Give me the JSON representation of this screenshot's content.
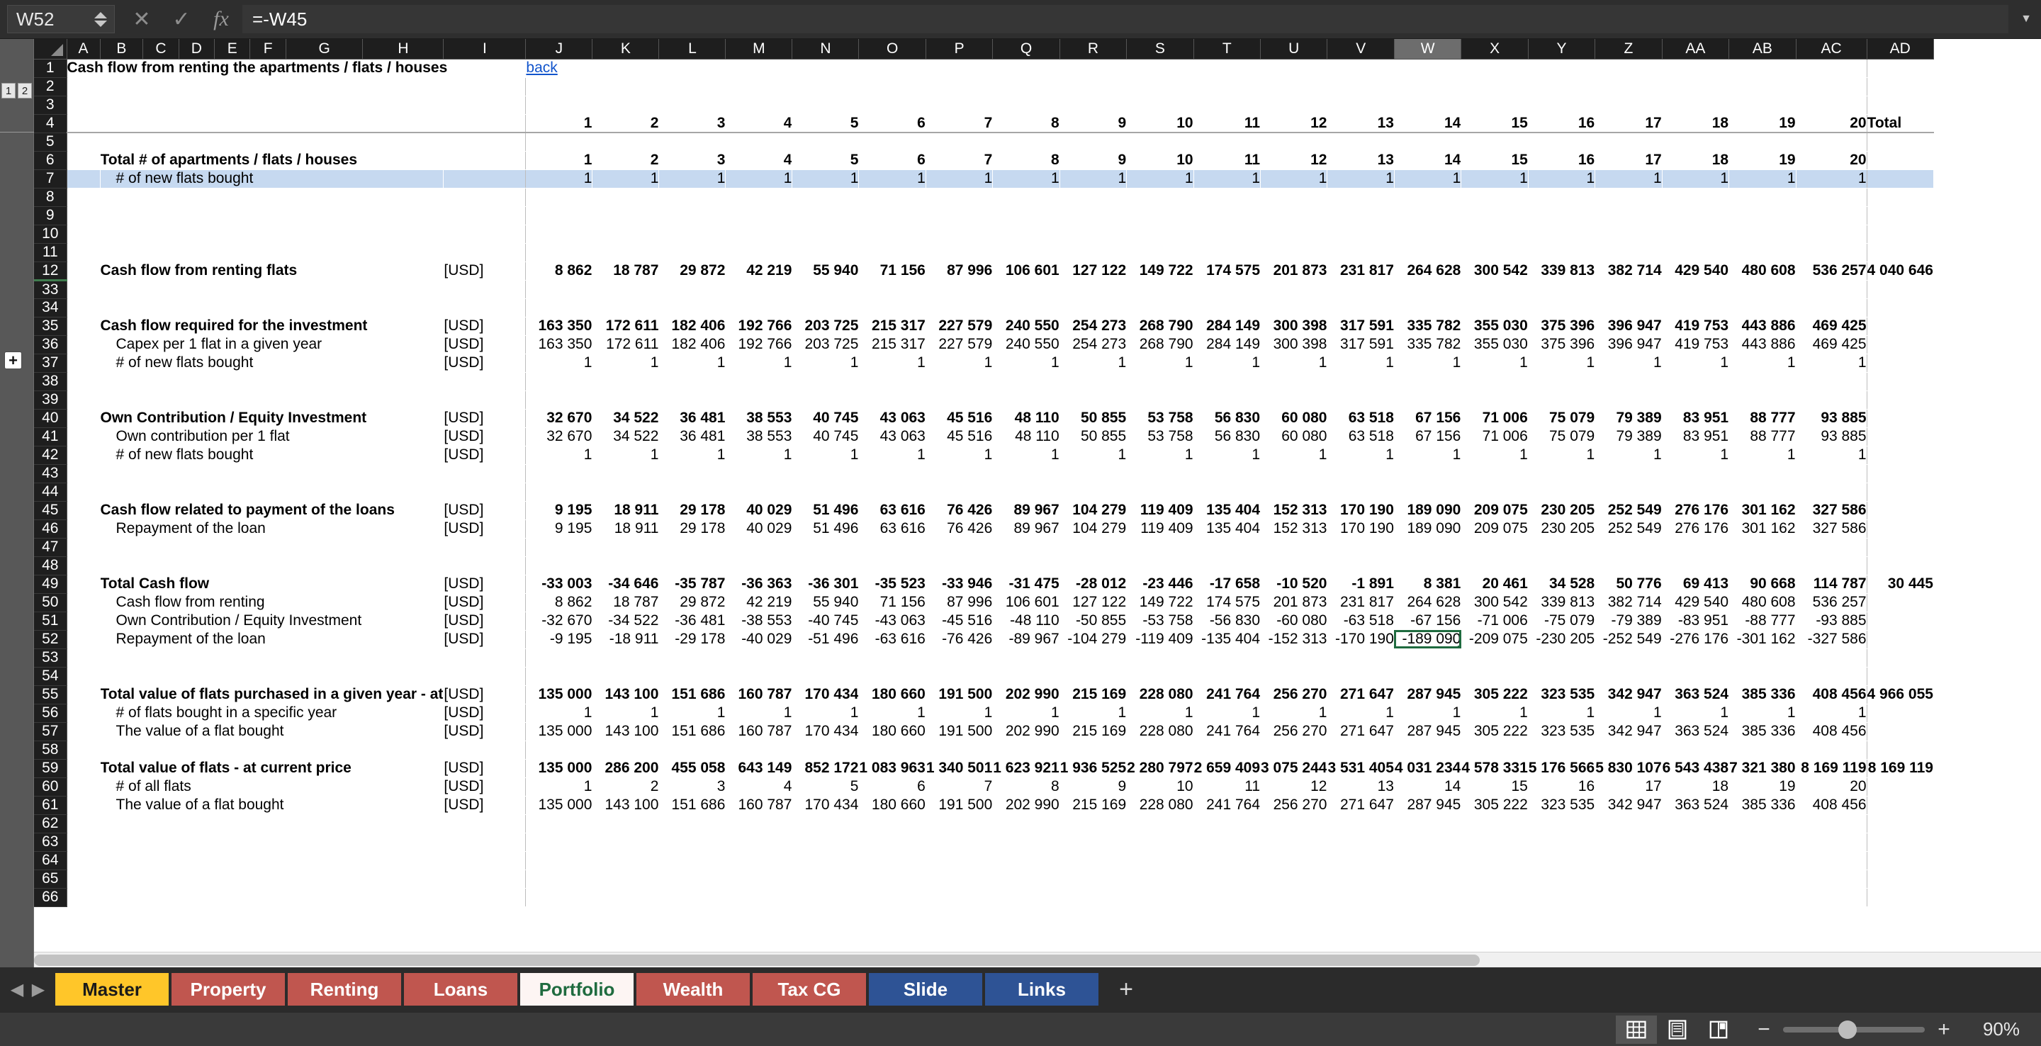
{
  "formula_bar": {
    "name_box": "W52",
    "cancel_icon": "close-icon",
    "accept_icon": "check-icon",
    "function_icon": "fx-icon",
    "formula": "=-W45",
    "expand_icon": "chevron-down-icon"
  },
  "outline": {
    "level_1": "1",
    "level_2": "2",
    "expand": "+"
  },
  "columns": [
    "A",
    "B",
    "C",
    "D",
    "E",
    "F",
    "G",
    "H",
    "I",
    "J",
    "K",
    "L",
    "M",
    "N",
    "O",
    "P",
    "Q",
    "R",
    "S",
    "T",
    "U",
    "V",
    "W",
    "X",
    "Y",
    "Z",
    "AA",
    "AB",
    "AC",
    "AD"
  ],
  "selected_column": "W",
  "rows": [
    "1",
    "2",
    "3",
    "4",
    "5",
    "6",
    "7",
    "8",
    "9",
    "10",
    "11",
    "12",
    "33",
    "34",
    "35",
    "36",
    "37",
    "38",
    "39",
    "40",
    "41",
    "42",
    "43",
    "44",
    "45",
    "46",
    "47",
    "48",
    "49",
    "50",
    "51",
    "52",
    "53",
    "54",
    "55",
    "56",
    "57",
    "58",
    "59",
    "60",
    "61",
    "62",
    "63",
    "64",
    "65",
    "66"
  ],
  "title": "Cash flow from renting the apartments / flats / houses",
  "back_link": "back",
  "year_headers": [
    "1",
    "2",
    "3",
    "4",
    "5",
    "6",
    "7",
    "8",
    "9",
    "10",
    "11",
    "12",
    "13",
    "14",
    "15",
    "16",
    "17",
    "18",
    "19",
    "20"
  ],
  "total_header": "Total",
  "unit": "[USD]",
  "sheet_rows": [
    {
      "row": "6",
      "label": "Total # of apartments / flats / houses",
      "bold": true,
      "indent": 0,
      "unit": "",
      "values": [
        "1",
        "2",
        "3",
        "4",
        "5",
        "6",
        "7",
        "8",
        "9",
        "10",
        "11",
        "12",
        "13",
        "14",
        "15",
        "16",
        "17",
        "18",
        "19",
        "20"
      ],
      "total": ""
    },
    {
      "row": "7",
      "label": "# of new flats bought",
      "bold": false,
      "indent": 1,
      "unit": "",
      "highlight": true,
      "values": [
        "1",
        "1",
        "1",
        "1",
        "1",
        "1",
        "1",
        "1",
        "1",
        "1",
        "1",
        "1",
        "1",
        "1",
        "1",
        "1",
        "1",
        "1",
        "1",
        "1"
      ],
      "total": ""
    },
    {
      "row": "12",
      "label": "Cash flow from renting flats",
      "bold": true,
      "indent": 0,
      "unit": "[USD]",
      "values": [
        "8 862",
        "18 787",
        "29 872",
        "42 219",
        "55 940",
        "71 156",
        "87 996",
        "106 601",
        "127 122",
        "149 722",
        "174 575",
        "201 873",
        "231 817",
        "264 628",
        "300 542",
        "339 813",
        "382 714",
        "429 540",
        "480 608",
        "536 257"
      ],
      "total": "4 040 646"
    },
    {
      "row": "35",
      "label": "Cash flow required for the investment",
      "bold": true,
      "indent": 0,
      "unit": "[USD]",
      "values": [
        "163 350",
        "172 611",
        "182 406",
        "192 766",
        "203 725",
        "215 317",
        "227 579",
        "240 550",
        "254 273",
        "268 790",
        "284 149",
        "300 398",
        "317 591",
        "335 782",
        "355 030",
        "375 396",
        "396 947",
        "419 753",
        "443 886",
        "469 425"
      ],
      "total": ""
    },
    {
      "row": "36",
      "label": "Capex per 1 flat in a given year",
      "bold": false,
      "indent": 1,
      "unit": "[USD]",
      "values": [
        "163 350",
        "172 611",
        "182 406",
        "192 766",
        "203 725",
        "215 317",
        "227 579",
        "240 550",
        "254 273",
        "268 790",
        "284 149",
        "300 398",
        "317 591",
        "335 782",
        "355 030",
        "375 396",
        "396 947",
        "419 753",
        "443 886",
        "469 425"
      ],
      "total": ""
    },
    {
      "row": "37",
      "label": "# of new flats bought",
      "bold": false,
      "indent": 1,
      "unit": "[USD]",
      "values": [
        "1",
        "1",
        "1",
        "1",
        "1",
        "1",
        "1",
        "1",
        "1",
        "1",
        "1",
        "1",
        "1",
        "1",
        "1",
        "1",
        "1",
        "1",
        "1",
        "1"
      ],
      "total": ""
    },
    {
      "row": "40",
      "label": "Own Contribution / Equity Investment",
      "bold": true,
      "indent": 0,
      "unit": "[USD]",
      "values": [
        "32 670",
        "34 522",
        "36 481",
        "38 553",
        "40 745",
        "43 063",
        "45 516",
        "48 110",
        "50 855",
        "53 758",
        "56 830",
        "60 080",
        "63 518",
        "67 156",
        "71 006",
        "75 079",
        "79 389",
        "83 951",
        "88 777",
        "93 885"
      ],
      "total": ""
    },
    {
      "row": "41",
      "label": "Own contribution per 1 flat",
      "bold": false,
      "indent": 1,
      "unit": "[USD]",
      "values": [
        "32 670",
        "34 522",
        "36 481",
        "38 553",
        "40 745",
        "43 063",
        "45 516",
        "48 110",
        "50 855",
        "53 758",
        "56 830",
        "60 080",
        "63 518",
        "67 156",
        "71 006",
        "75 079",
        "79 389",
        "83 951",
        "88 777",
        "93 885"
      ],
      "total": ""
    },
    {
      "row": "42",
      "label": "# of new flats bought",
      "bold": false,
      "indent": 1,
      "unit": "[USD]",
      "values": [
        "1",
        "1",
        "1",
        "1",
        "1",
        "1",
        "1",
        "1",
        "1",
        "1",
        "1",
        "1",
        "1",
        "1",
        "1",
        "1",
        "1",
        "1",
        "1",
        "1"
      ],
      "total": ""
    },
    {
      "row": "45",
      "label": "Cash flow related to payment of the loans",
      "bold": true,
      "indent": 0,
      "unit": "[USD]",
      "values": [
        "9 195",
        "18 911",
        "29 178",
        "40 029",
        "51 496",
        "63 616",
        "76 426",
        "89 967",
        "104 279",
        "119 409",
        "135 404",
        "152 313",
        "170 190",
        "189 090",
        "209 075",
        "230 205",
        "252 549",
        "276 176",
        "301 162",
        "327 586"
      ],
      "total": ""
    },
    {
      "row": "46",
      "label": "Repayment of the loan",
      "bold": false,
      "indent": 1,
      "unit": "[USD]",
      "values": [
        "9 195",
        "18 911",
        "29 178",
        "40 029",
        "51 496",
        "63 616",
        "76 426",
        "89 967",
        "104 279",
        "119 409",
        "135 404",
        "152 313",
        "170 190",
        "189 090",
        "209 075",
        "230 205",
        "252 549",
        "276 176",
        "301 162",
        "327 586"
      ],
      "total": ""
    },
    {
      "row": "49",
      "label": "Total Cash flow",
      "bold": true,
      "indent": 0,
      "unit": "[USD]",
      "values": [
        "-33 003",
        "-34 646",
        "-35 787",
        "-36 363",
        "-36 301",
        "-35 523",
        "-33 946",
        "-31 475",
        "-28 012",
        "-23 446",
        "-17 658",
        "-10 520",
        "-1 891",
        "8 381",
        "20 461",
        "34 528",
        "50 776",
        "69 413",
        "90 668",
        "114 787"
      ],
      "total": "30 445"
    },
    {
      "row": "50",
      "label": "Cash flow from renting",
      "bold": false,
      "indent": 1,
      "unit": "[USD]",
      "values": [
        "8 862",
        "18 787",
        "29 872",
        "42 219",
        "55 940",
        "71 156",
        "87 996",
        "106 601",
        "127 122",
        "149 722",
        "174 575",
        "201 873",
        "231 817",
        "264 628",
        "300 542",
        "339 813",
        "382 714",
        "429 540",
        "480 608",
        "536 257"
      ],
      "total": ""
    },
    {
      "row": "51",
      "label": "Own Contribution / Equity Investment",
      "bold": false,
      "indent": 1,
      "unit": "[USD]",
      "values": [
        "-32 670",
        "-34 522",
        "-36 481",
        "-38 553",
        "-40 745",
        "-43 063",
        "-45 516",
        "-48 110",
        "-50 855",
        "-53 758",
        "-56 830",
        "-60 080",
        "-63 518",
        "-67 156",
        "-71 006",
        "-75 079",
        "-79 389",
        "-83 951",
        "-88 777",
        "-93 885"
      ],
      "total": ""
    },
    {
      "row": "52",
      "label": "Repayment of the loan",
      "bold": false,
      "indent": 1,
      "unit": "[USD]",
      "selected_index": 13,
      "values": [
        "-9 195",
        "-18 911",
        "-29 178",
        "-40 029",
        "-51 496",
        "-63 616",
        "-76 426",
        "-89 967",
        "-104 279",
        "-119 409",
        "-135 404",
        "-152 313",
        "-170 190",
        "-189 090",
        "-209 075",
        "-230 205",
        "-252 549",
        "-276 176",
        "-301 162",
        "-327 586"
      ],
      "total": ""
    },
    {
      "row": "55",
      "label": "Total value of flats purchased in a given year - at ",
      "bold": true,
      "indent": 0,
      "unit": "[USD]",
      "clipped": true,
      "values": [
        "135 000",
        "143 100",
        "151 686",
        "160 787",
        "170 434",
        "180 660",
        "191 500",
        "202 990",
        "215 169",
        "228 080",
        "241 764",
        "256 270",
        "271 647",
        "287 945",
        "305 222",
        "323 535",
        "342 947",
        "363 524",
        "385 336",
        "408 456"
      ],
      "total": "4 966 055"
    },
    {
      "row": "56",
      "label": "# of flats bought in a specific year",
      "bold": false,
      "indent": 1,
      "unit": "[USD]",
      "values": [
        "1",
        "1",
        "1",
        "1",
        "1",
        "1",
        "1",
        "1",
        "1",
        "1",
        "1",
        "1",
        "1",
        "1",
        "1",
        "1",
        "1",
        "1",
        "1",
        "1"
      ],
      "total": ""
    },
    {
      "row": "57",
      "label": "The value of a flat bought",
      "bold": false,
      "indent": 1,
      "unit": "[USD]",
      "values": [
        "135 000",
        "143 100",
        "151 686",
        "160 787",
        "170 434",
        "180 660",
        "191 500",
        "202 990",
        "215 169",
        "228 080",
        "241 764",
        "256 270",
        "271 647",
        "287 945",
        "305 222",
        "323 535",
        "342 947",
        "363 524",
        "385 336",
        "408 456"
      ],
      "total": ""
    },
    {
      "row": "59",
      "label": "Total value of flats - at current price",
      "bold": true,
      "indent": 0,
      "unit": "[USD]",
      "values": [
        "135 000",
        "286 200",
        "455 058",
        "643 149",
        "852 172",
        "1 083 963",
        "1 340 501",
        "1 623 921",
        "1 936 525",
        "2 280 797",
        "2 659 409",
        "3 075 244",
        "3 531 405",
        "4 031 234",
        "4 578 331",
        "5 176 566",
        "5 830 107",
        "6 543 438",
        "7 321 380",
        "8 169 119"
      ],
      "total": "8 169 119"
    },
    {
      "row": "60",
      "label": "# of all flats",
      "bold": false,
      "indent": 1,
      "unit": "[USD]",
      "values": [
        "1",
        "2",
        "3",
        "4",
        "5",
        "6",
        "7",
        "8",
        "9",
        "10",
        "11",
        "12",
        "13",
        "14",
        "15",
        "16",
        "17",
        "18",
        "19",
        "20"
      ],
      "total": ""
    },
    {
      "row": "61",
      "label": "The value of a flat bought",
      "bold": false,
      "indent": 1,
      "unit": "[USD]",
      "values": [
        "135 000",
        "143 100",
        "151 686",
        "160 787",
        "170 434",
        "180 660",
        "191 500",
        "202 990",
        "215 169",
        "228 080",
        "241 764",
        "256 270",
        "271 647",
        "287 945",
        "305 222",
        "323 535",
        "342 947",
        "363 524",
        "385 336",
        "408 456"
      ],
      "total": ""
    }
  ],
  "tabs": [
    {
      "label": "Master",
      "style": "master",
      "active": false
    },
    {
      "label": "Property",
      "style": "red",
      "active": false
    },
    {
      "label": "Renting",
      "style": "red",
      "active": false
    },
    {
      "label": "Loans",
      "style": "red",
      "active": false
    },
    {
      "label": "Portfolio",
      "style": "active",
      "active": true
    },
    {
      "label": "Wealth",
      "style": "red",
      "active": false
    },
    {
      "label": "Tax CG",
      "style": "red",
      "active": false
    },
    {
      "label": "Slide",
      "style": "blue",
      "active": false
    },
    {
      "label": "Links",
      "style": "blue",
      "active": false
    }
  ],
  "tab_add": "+",
  "tab_prev": "◀",
  "tab_next": "▶",
  "status": {
    "view_normal_icon": "grid-view-icon",
    "view_pagebreak_icon": "page-view-icon",
    "view_layout_icon": "book-view-icon",
    "zoom_out": "−",
    "zoom_in": "+",
    "zoom_level": "90%"
  },
  "colors": {
    "accent_green": "#1f6b3f",
    "selection_blue": "#c6d9f0",
    "link_blue": "#1154cc"
  }
}
